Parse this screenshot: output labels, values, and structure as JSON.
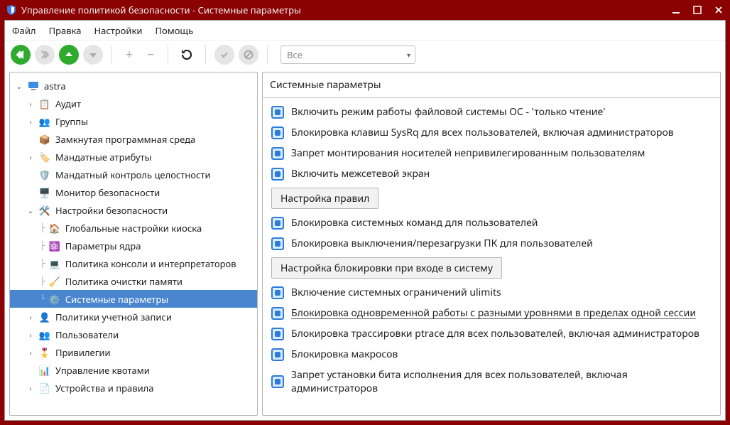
{
  "window": {
    "title": "Управление политикой безопасности - Системные параметры"
  },
  "menu": {
    "file": "Файл",
    "edit": "Правка",
    "settings": "Настройки",
    "help": "Помощь"
  },
  "toolbar": {
    "filter_label": "Все"
  },
  "tree": {
    "root": "astra",
    "audit": "Аудит",
    "groups": "Группы",
    "closed_env": "Замкнутая программная среда",
    "mand_attrs": "Мандатные атрибуты",
    "mand_integrity": "Мандатный контроль целостности",
    "sec_monitor": "Монитор безопасности",
    "sec_settings": "Настройки безопасности",
    "kiosk": "Глобальные настройки киоска",
    "kernel": "Параметры ядра",
    "console_policy": "Политика консоли и интерпретаторов",
    "mem_policy": "Политика очистки памяти",
    "sys_params": "Системные параметры",
    "acct_policies": "Политики учетной записи",
    "users": "Пользователи",
    "privileges": "Привилегии",
    "quotas": "Управление квотами",
    "devices": "Устройства и правила"
  },
  "content": {
    "header": "Системные параметры",
    "opt_readonly_fs": "Включить режим работы файловой системы ОС - 'только чтение'",
    "opt_block_sysrq": "Блокировка клавиш SysRq для всех пользователей, включая администраторов",
    "opt_block_mount": "Запрет монтирования носителей непривилегированным пользователям",
    "opt_enable_firewall": "Включить межсетевой экран",
    "btn_rules": "Настройка правил",
    "opt_block_syscmd": "Блокировка системных команд для пользователей",
    "opt_block_shutdown": "Блокировка выключения/перезагрузки ПК для пользователей",
    "btn_login_lock": "Настройка блокировки при входе в систему",
    "opt_ulimits": "Включение системных ограничений ulimits",
    "opt_block_levels": "Блокировка одновременной работы с разными уровнями в пределах одной сессии",
    "opt_block_ptrace": "Блокировка трассировки ptrace для всех пользователей, включая администраторов",
    "opt_block_macros": "Блокировка макросов",
    "opt_block_execbit": "Запрет установки бита исполнения для всех пользователей, включая администраторов"
  }
}
